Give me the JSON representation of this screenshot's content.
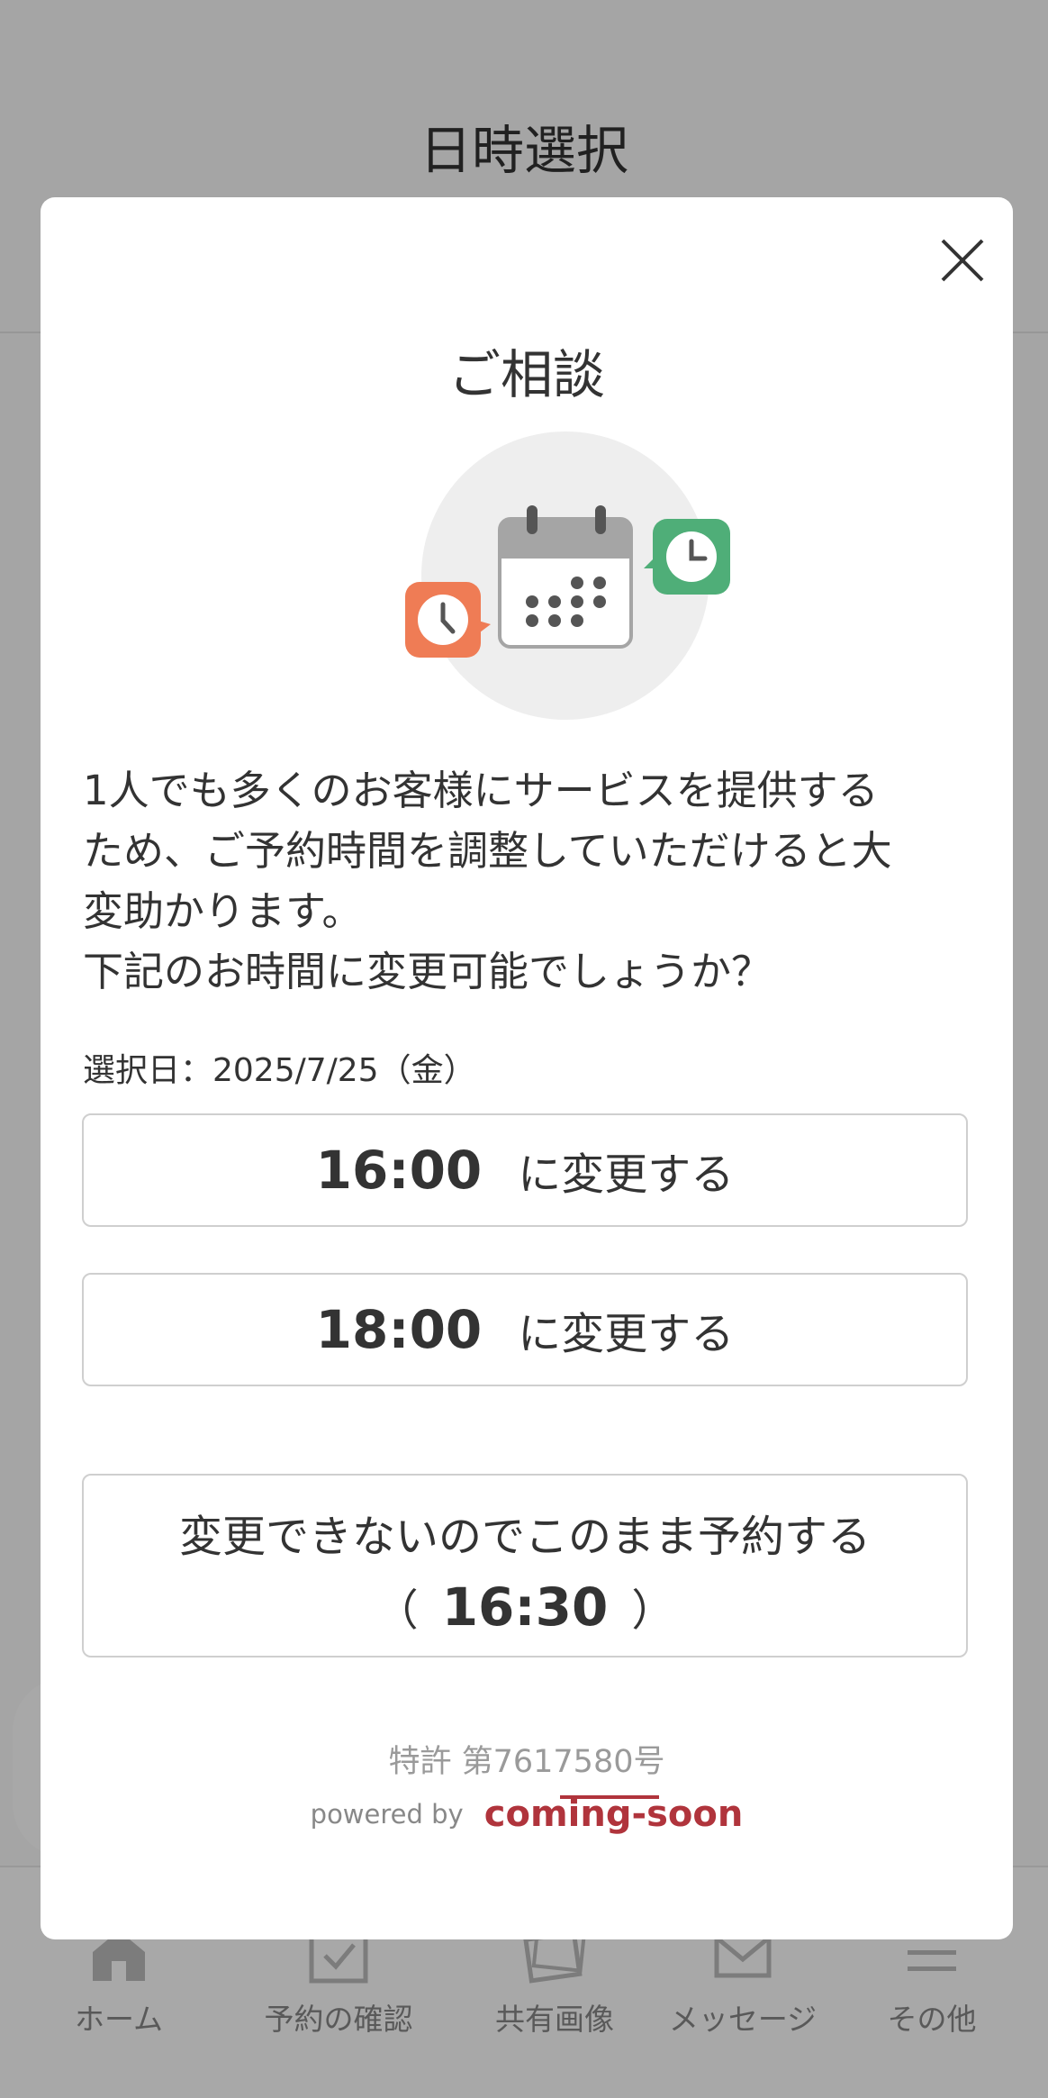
{
  "background": {
    "header_title": "日時選択",
    "tabs": [
      {
        "label": "ホーム",
        "icon": "home-icon"
      },
      {
        "label": "予約の確認",
        "icon": "calendar-check-icon"
      },
      {
        "label": "共有画像",
        "icon": "images-icon"
      },
      {
        "label": "メッセージ",
        "icon": "mail-icon"
      },
      {
        "label": "その他",
        "icon": "menu-icon"
      }
    ]
  },
  "modal": {
    "title": "ご相談",
    "close_icon": "close-icon",
    "illustration_icons": [
      "calendar-icon",
      "clock-icon",
      "clock-icon"
    ],
    "message_lines": [
      "1人でも多くのお客様にサービスを提供する",
      "ため、ご予約時間を調整していただけると大",
      "変助かります。",
      "下記のお時間に変更可能でしょうか？"
    ],
    "selected_date": "選択日：2025/7/25（金）",
    "options": [
      {
        "time": "16:00",
        "suffix": "に変更する"
      },
      {
        "time": "18:00",
        "suffix": "に変更する"
      }
    ],
    "keep": {
      "label": "変更できないのでこのまま予約する",
      "open_paren": "（",
      "time": "16:30",
      "close_paren": "）"
    },
    "patent": "特許 第7617580号",
    "powered_by": "powered by",
    "brand": "coming-soon"
  },
  "colors": {
    "overlay": "#000000",
    "clock_orange": "#ef7c55",
    "clock_green": "#4fae78",
    "brand_red": "#b0343c",
    "text": "#333333"
  }
}
